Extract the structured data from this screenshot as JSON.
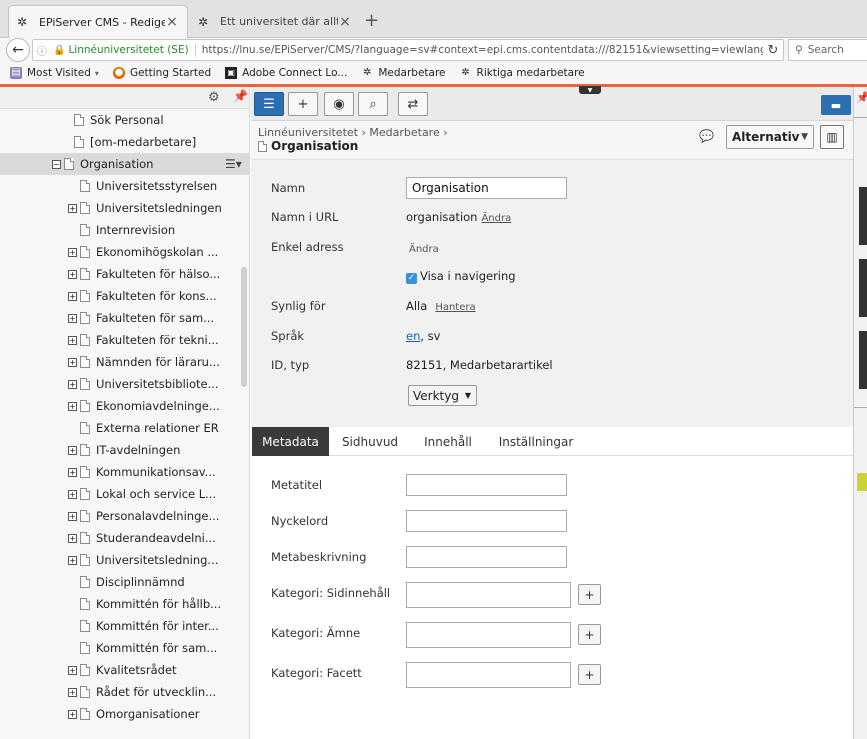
{
  "browser": {
    "tabs": [
      {
        "title": "EPiServer CMS - Redigera",
        "active": true
      },
      {
        "title": "Ett universitet där allt är m...",
        "active": false
      }
    ],
    "new_tab": "+",
    "site_identity": "Linnéuniversitetet (SE)",
    "url": "https://lnu.se/EPiServer/CMS/?language=sv#context=epi.cms.contentdata:///82151&viewsetting=viewlanguage:///sv",
    "search_placeholder": "Search",
    "bookmarks": [
      "Most Visited",
      "Getting Started",
      "Adobe Connect Lo...",
      "Medarbetare",
      "Riktiga medarbetare"
    ]
  },
  "tree": {
    "items": [
      {
        "label": "Sök Personal",
        "expander": "",
        "indent": 1
      },
      {
        "label": "[om-medarbetare]",
        "expander": "",
        "indent": 1
      },
      {
        "label": "Organisation",
        "expander": "−",
        "indent": 0,
        "selected": true
      },
      {
        "label": "Universitetsstyrelsen",
        "expander": "",
        "indent": 2
      },
      {
        "label": "Universitetsledningen",
        "expander": "+",
        "indent": 2
      },
      {
        "label": "Internrevision",
        "expander": "",
        "indent": 2
      },
      {
        "label": "Ekonomihögskolan ...",
        "expander": "+",
        "indent": 2
      },
      {
        "label": "Fakulteten för hälso...",
        "expander": "+",
        "indent": 2
      },
      {
        "label": "Fakulteten för kons...",
        "expander": "+",
        "indent": 2
      },
      {
        "label": "Fakulteten för sam...",
        "expander": "+",
        "indent": 2
      },
      {
        "label": "Fakulteten för tekni...",
        "expander": "+",
        "indent": 2
      },
      {
        "label": "Nämnden för läraru...",
        "expander": "+",
        "indent": 2
      },
      {
        "label": "Universitetsbibliote...",
        "expander": "+",
        "indent": 2
      },
      {
        "label": "Ekonomiavdelninge...",
        "expander": "+",
        "indent": 2
      },
      {
        "label": "Externa relationer ER",
        "expander": "",
        "indent": 2
      },
      {
        "label": "IT-avdelningen",
        "expander": "+",
        "indent": 2
      },
      {
        "label": "Kommunikationsav...",
        "expander": "+",
        "indent": 2
      },
      {
        "label": "Lokal och service L...",
        "expander": "+",
        "indent": 2
      },
      {
        "label": "Personalavdelninge...",
        "expander": "+",
        "indent": 2
      },
      {
        "label": "Studerandeavdelni...",
        "expander": "+",
        "indent": 2
      },
      {
        "label": "Universitetsledning...",
        "expander": "+",
        "indent": 2
      },
      {
        "label": "Disciplinnämnd",
        "expander": "",
        "indent": 2
      },
      {
        "label": "Kommittén för hållb...",
        "expander": "",
        "indent": 2
      },
      {
        "label": "Kommittén för inter...",
        "expander": "",
        "indent": 2
      },
      {
        "label": "Kommittén för sam...",
        "expander": "",
        "indent": 2
      },
      {
        "label": "Kvalitetsrådet",
        "expander": "+",
        "indent": 2
      },
      {
        "label": "Rådet för utvecklin...",
        "expander": "+",
        "indent": 2
      },
      {
        "label": "Omorganisationer",
        "expander": "+",
        "indent": 2
      }
    ]
  },
  "header": {
    "crumb1": "Linnéuniversitetet",
    "crumb2": "Medarbetare",
    "title": "Organisation",
    "alt_button": "Alternativ"
  },
  "props": {
    "name_label": "Namn",
    "name_value": "Organisation",
    "url_label": "Namn i URL",
    "url_value": "organisation",
    "change": "Ändra",
    "simple_label": "Enkel adress",
    "nav_label": "Visa i navigering",
    "visible_label": "Synlig för",
    "visible_value": "Alla",
    "manage": "Hantera",
    "lang_label": "Språk",
    "lang_en": "en",
    "lang_rest": ", sv",
    "id_label": "ID, typ",
    "id_value": "82151, Medarbetarartikel",
    "tools": "Verktyg"
  },
  "content_tabs": [
    "Metadata",
    "Sidhuvud",
    "Innehåll",
    "Inställningar"
  ],
  "form": {
    "metatitle": "Metatitel",
    "keywords": "Nyckelord",
    "metadesc": "Metabeskrivning",
    "cat_content": "Kategori: Sidinnehåll",
    "cat_subject": "Kategori: Ämne",
    "cat_facet": "Kategori: Facett",
    "plus": "+"
  }
}
